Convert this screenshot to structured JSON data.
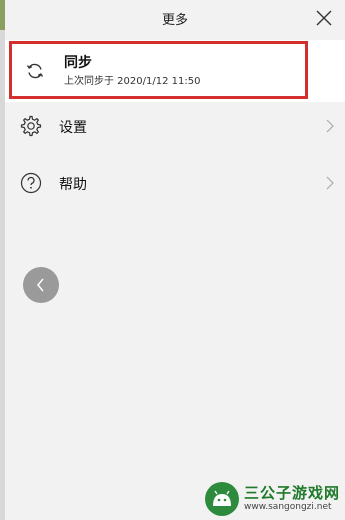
{
  "header": {
    "title": "更多"
  },
  "icons": {
    "close": "close-icon",
    "sync": "sync-icon",
    "settings": "gear-icon",
    "help": "question-circle-icon",
    "chevron": "chevron-right-icon",
    "back": "chevron-left-icon"
  },
  "menu": {
    "sync": {
      "label": "同步",
      "subtitle": "上次同步于 2020/1/12 11:50"
    },
    "settings": {
      "label": "设置"
    },
    "help": {
      "label": "帮助"
    }
  },
  "watermark": {
    "text": "三公子游戏网",
    "url": "www.sangongzi.net"
  },
  "colors": {
    "highlight": "#d32f2f",
    "background": "#f2f2f2",
    "watermark_green": "#2e8b3d"
  }
}
